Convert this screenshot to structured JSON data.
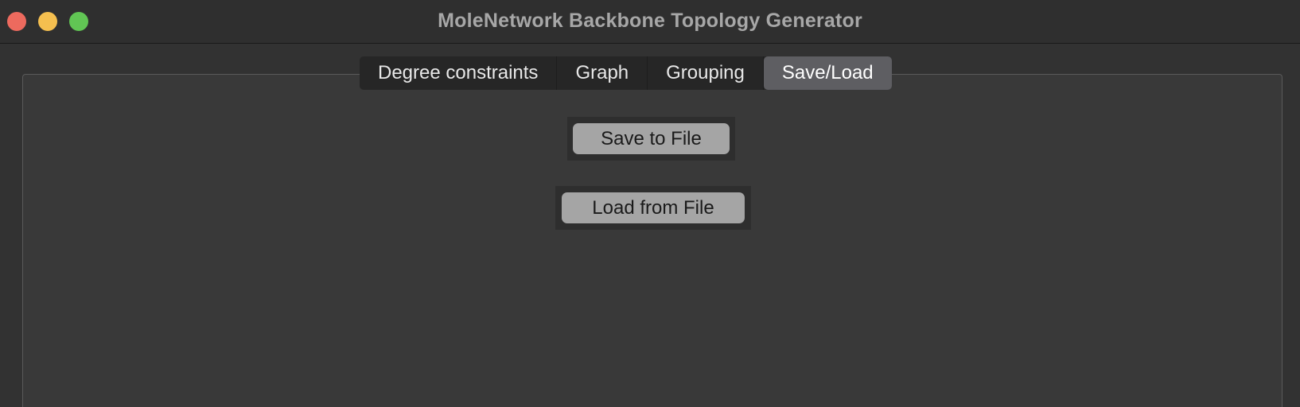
{
  "window": {
    "title": "MoleNetwork Backbone Topology Generator"
  },
  "tabs": [
    {
      "label": "Degree constraints",
      "active": false
    },
    {
      "label": "Graph",
      "active": false
    },
    {
      "label": "Grouping",
      "active": false
    },
    {
      "label": "Save/Load",
      "active": true
    }
  ],
  "actions": {
    "save_label": "Save to File",
    "load_label": "Load from File"
  },
  "colors": {
    "close": "#ed6a5e",
    "minimize": "#f5bf4f",
    "zoom": "#61c554",
    "active_tab": "#5e5e62",
    "button": "#a5a5a5"
  }
}
